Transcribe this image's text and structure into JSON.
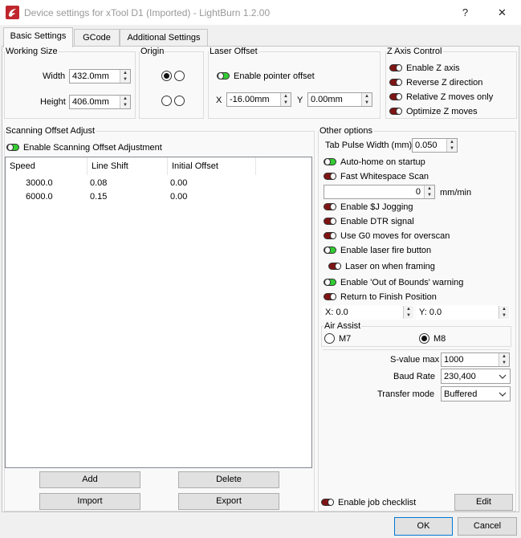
{
  "window": {
    "title": "Device settings for xTool D1 (Imported) - LightBurn 1.2.00",
    "help_glyph": "?",
    "close_glyph": "✕"
  },
  "tabs": [
    "Basic Settings",
    "GCode",
    "Additional Settings"
  ],
  "working_size": {
    "title": "Working Size",
    "width_label": "Width",
    "width_value": "432.0mm",
    "height_label": "Height",
    "height_value": "406.0mm"
  },
  "origin": {
    "title": "Origin",
    "selected": "top-left"
  },
  "laser_offset": {
    "title": "Laser Offset",
    "enable_label": "Enable pointer offset",
    "enabled": true,
    "x_label": "X",
    "x_value": "-16.00mm",
    "y_label": "Y",
    "y_value": "0.00mm"
  },
  "z_axis": {
    "title": "Z Axis Control",
    "items": [
      {
        "label": "Enable Z axis",
        "on": false
      },
      {
        "label": "Reverse Z direction",
        "on": false
      },
      {
        "label": "Relative Z moves only",
        "on": false
      },
      {
        "label": "Optimize Z moves",
        "on": false
      }
    ]
  },
  "scanning": {
    "title": "Scanning Offset Adjust",
    "enable_label": "Enable Scanning Offset Adjustment",
    "enabled": true,
    "columns": [
      "Speed",
      "Line Shift",
      "Initial Offset"
    ],
    "rows": [
      [
        "3000.0",
        "0.08",
        "0.00"
      ],
      [
        "6000.0",
        "0.15",
        "0.00"
      ]
    ],
    "add_label": "Add",
    "delete_label": "Delete",
    "import_label": "Import",
    "export_label": "Export"
  },
  "other": {
    "title": "Other options",
    "tab_pulse_label": "Tab Pulse Width (mm)",
    "tab_pulse_value": "0.050",
    "auto_home": {
      "label": "Auto-home on startup",
      "on": true
    },
    "fast_whitespace": {
      "label": "Fast Whitespace Scan",
      "on": false
    },
    "whitespace_value": "0",
    "whitespace_unit": "mm/min",
    "jogging": {
      "label": "Enable $J Jogging",
      "on": false
    },
    "dtr": {
      "label": "Enable DTR signal",
      "on": false
    },
    "g0_overscan": {
      "label": "Use G0 moves for overscan",
      "on": false
    },
    "fire_button": {
      "label": "Enable laser fire button",
      "on": true
    },
    "laser_framing": {
      "label": "Laser on when framing",
      "on": false
    },
    "out_of_bounds": {
      "label": "Enable 'Out of Bounds' warning",
      "on": true
    },
    "return_finish": {
      "label": "Return to Finish Position",
      "on": false
    },
    "finish_x_label": "X:",
    "finish_x_value": "0.0",
    "finish_y_label": "Y:",
    "finish_y_value": "0.0",
    "air_assist_title": "Air Assist",
    "air_m7_label": "M7",
    "air_m8_label": "M8",
    "air_selected": "M8",
    "svalue_label": "S-value max",
    "svalue_value": "1000",
    "baud_label": "Baud Rate",
    "baud_value": "230,400",
    "transfer_label": "Transfer mode",
    "transfer_value": "Buffered"
  },
  "job_checklist": {
    "label": "Enable job checklist",
    "on": false,
    "edit_label": "Edit"
  },
  "footer": {
    "ok_label": "OK",
    "cancel_label": "Cancel"
  },
  "colors": {
    "toggle_on": "#32cd32",
    "toggle_off": "#7f1414",
    "window_bg": "#f0f0f0"
  }
}
